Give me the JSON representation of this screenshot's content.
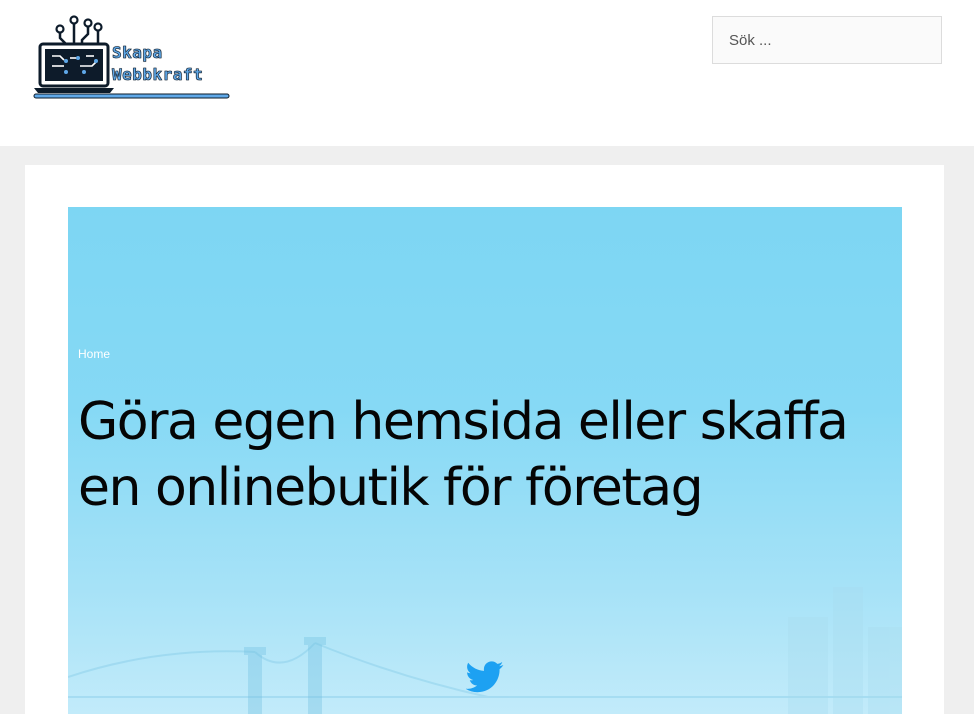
{
  "header": {
    "logo": {
      "line1": "Skapa",
      "line2": "Webbkraft",
      "icon": "laptop-circuit-icon"
    },
    "search": {
      "placeholder": "Sök ..."
    }
  },
  "hero": {
    "breadcrumb": "Home",
    "title": "Göra egen hemsida eller skaffa en onlinebutik för företag",
    "share_icon": "twitter-icon"
  },
  "colors": {
    "hero_top": "#7dd6f3",
    "hero_bottom": "#c2ebfa",
    "page_bg": "#efefef",
    "twitter": "#1da1f2",
    "logo_accent": "#5fa8e8"
  }
}
